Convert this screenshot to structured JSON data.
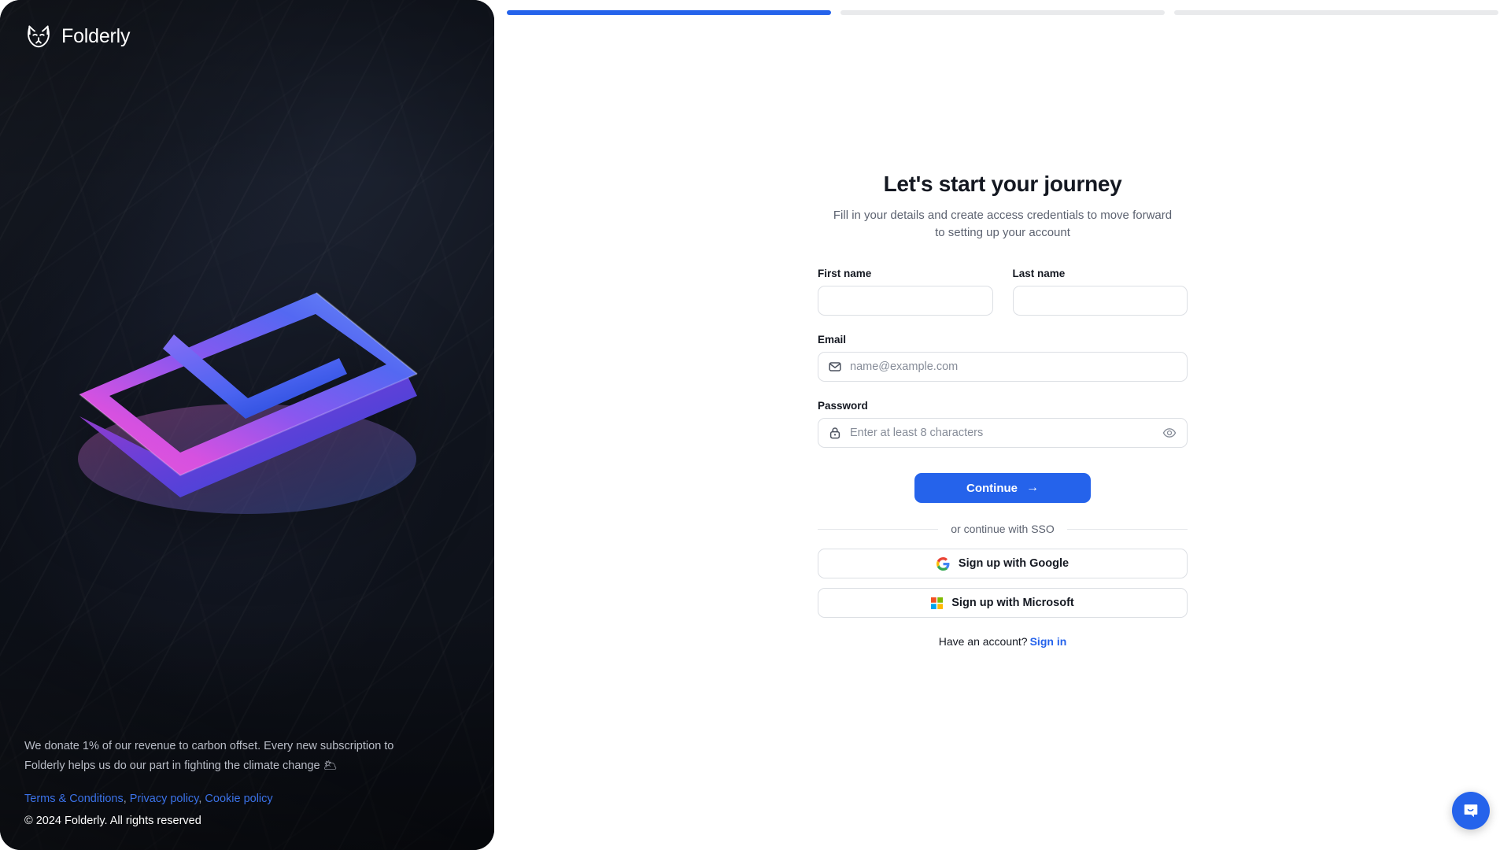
{
  "brand": {
    "name": "Folderly",
    "logo_icon": "fox-head-icon"
  },
  "progress": {
    "segments": 3,
    "active_index": 0,
    "active_color": "#2563eb",
    "inactive_color": "#e9eaec"
  },
  "form": {
    "title": "Let's start your journey",
    "subtitle": "Fill in your details and create access credentials to move forward to setting up your account",
    "first_name": {
      "label": "First name",
      "value": "",
      "placeholder": ""
    },
    "last_name": {
      "label": "Last name",
      "value": "",
      "placeholder": ""
    },
    "email": {
      "label": "Email",
      "value": "",
      "placeholder": "name@example.com",
      "icon": "envelope-icon"
    },
    "password": {
      "label": "Password",
      "value": "",
      "placeholder": "Enter at least 8 characters",
      "icon": "lock-icon",
      "toggle_icon": "eye-icon"
    },
    "continue_label": "Continue",
    "continue_arrow": "→",
    "divider_label": "or continue with SSO",
    "google_label": "Sign up with Google",
    "microsoft_label": "Sign up with Microsoft",
    "have_account": "Have an account?",
    "sign_in_label": "Sign in"
  },
  "panel": {
    "illustration": "3d-envelope-illustration",
    "donate_text": "We donate 1% of our revenue to carbon offset. Every new subscription to Folderly helps us do our part in fighting the climate change 🌥",
    "links": [
      {
        "label": "Terms & Conditions"
      },
      {
        "label": "Privacy policy"
      },
      {
        "label": "Cookie policy"
      }
    ],
    "link_separator": ", ",
    "copyright": "© 2024 Folderly. All rights reserved"
  },
  "chat": {
    "icon": "chat-bubble-icon"
  },
  "colors": {
    "accent": "#2563eb",
    "panel_bg": "#0f131c",
    "text_primary": "#141821",
    "text_muted": "#5c6270",
    "border": "#dcdfe4"
  }
}
